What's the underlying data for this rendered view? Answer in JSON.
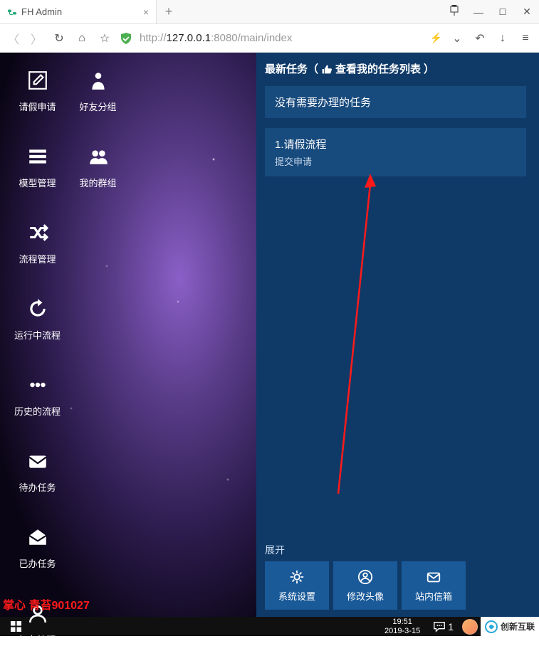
{
  "tab": {
    "title": "FH Admin"
  },
  "url": {
    "prefix": "http://",
    "host": "127.0.0.1",
    "port": ":8080",
    "path": "/main/index"
  },
  "sidebar_col1": [
    {
      "label": "请假申请",
      "icon": "edit"
    },
    {
      "label": "模型管理",
      "icon": "list"
    },
    {
      "label": "流程管理",
      "icon": "shuffle"
    },
    {
      "label": "运行中流程",
      "icon": "refresh"
    },
    {
      "label": "历史的流程",
      "icon": "dots"
    },
    {
      "label": "待办任务",
      "icon": "mail"
    },
    {
      "label": "已办任务",
      "icon": "mailopen"
    },
    {
      "label": "好友管理",
      "icon": "user"
    }
  ],
  "sidebar_col2": [
    {
      "label": "好友分组",
      "icon": "person"
    },
    {
      "label": "我的群组",
      "icon": "group"
    }
  ],
  "watermark": "掌心 青苔901027",
  "right": {
    "header_pre": "最新任务（",
    "header_link": "查看我的任务列表",
    "header_post": "）",
    "task1": "没有需要办理的任务",
    "task2_title": "1.请假流程",
    "task2_sub": "提交申请",
    "expand": "展开",
    "buttons": [
      {
        "label": "系统设置",
        "icon": "gear"
      },
      {
        "label": "修改头像",
        "icon": "usercircle"
      },
      {
        "label": "站内信箱",
        "icon": "envelope"
      }
    ]
  },
  "taskbar": {
    "time": "19:51",
    "date": "2019-3-15",
    "chatcount": "1",
    "brand": "创新互联"
  }
}
